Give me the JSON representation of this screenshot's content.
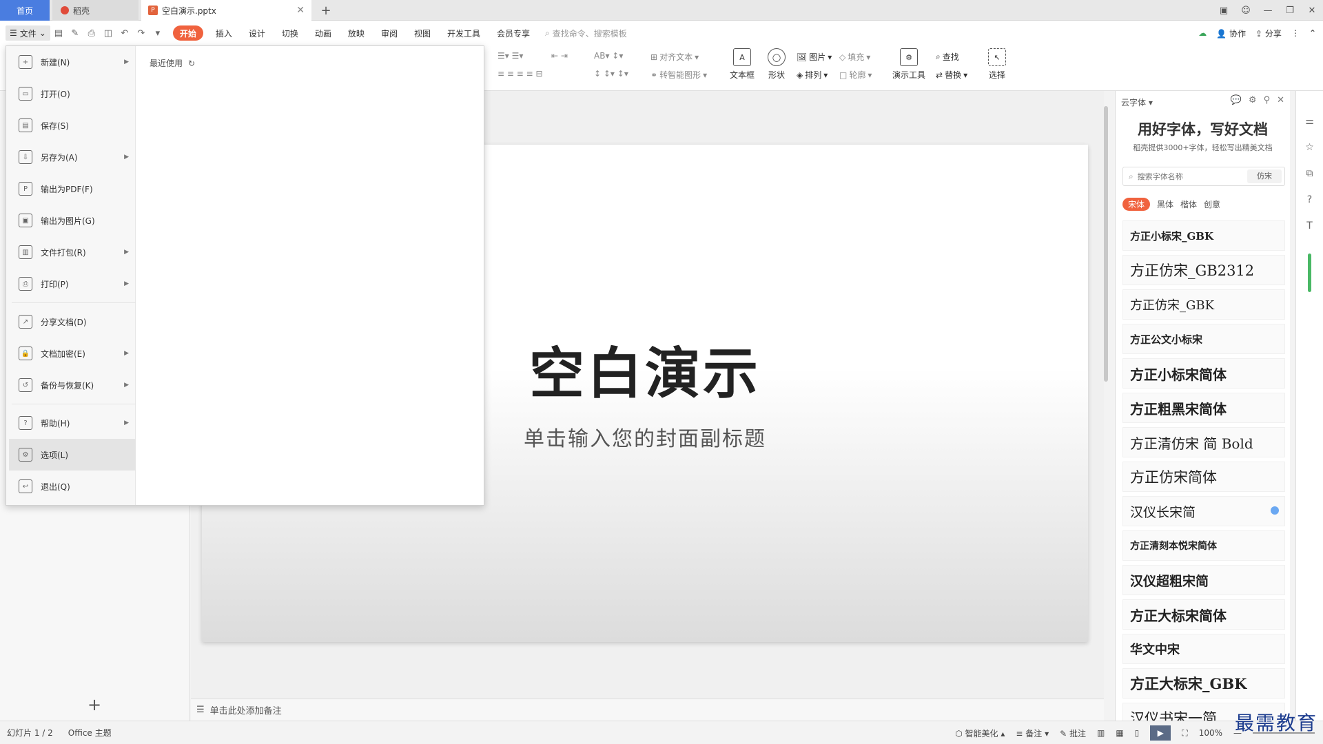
{
  "tabs": {
    "home": "首页",
    "docer": "稻壳",
    "file": "空白演示.pptx",
    "add": "+"
  },
  "menubar": {
    "file_menu_label": "文件",
    "tabs": [
      "开始",
      "插入",
      "设计",
      "切换",
      "动画",
      "放映",
      "审阅",
      "视图",
      "开发工具",
      "会员专享"
    ],
    "search_placeholder": "查找命令、搜索模板",
    "collab": "协作",
    "share": "分享"
  },
  "ribbon": {
    "align_text": "对齐文本",
    "smart_shape": "转智能图形",
    "textbox": "文本框",
    "shape": "形状",
    "picture": "图片",
    "fill": "填充",
    "arrange": "排列",
    "outline": "轮廓",
    "presentation_tools": "演示工具",
    "find": "查找",
    "replace": "替换",
    "select": "选择"
  },
  "file_menu": {
    "items": [
      {
        "label": "新建(N)",
        "arrow": true
      },
      {
        "label": "打开(O)",
        "arrow": false
      },
      {
        "label": "保存(S)",
        "arrow": false
      },
      {
        "label": "另存为(A)",
        "arrow": true
      },
      {
        "label": "输出为PDF(F)",
        "arrow": false
      },
      {
        "label": "输出为图片(G)",
        "arrow": false
      },
      {
        "label": "文件打包(R)",
        "arrow": true
      },
      {
        "label": "打印(P)",
        "arrow": true
      },
      {
        "label": "分享文档(D)",
        "arrow": false
      },
      {
        "label": "文档加密(E)",
        "arrow": true
      },
      {
        "label": "备份与恢复(K)",
        "arrow": true
      },
      {
        "label": "帮助(H)",
        "arrow": true
      },
      {
        "label": "选项(L)",
        "arrow": false
      },
      {
        "label": "退出(Q)",
        "arrow": false
      }
    ],
    "recent_label": "最近使用"
  },
  "slide": {
    "title": "空白演示",
    "subtitle": "单击输入您的封面副标题"
  },
  "notes_placeholder": "单击此处添加备注",
  "font_panel": {
    "header": "云字体",
    "title": "用好字体，写好文档",
    "description": "稻壳提供3000+字体，轻松写出精美文档",
    "search_placeholder": "搜索字体名称",
    "search_tag": "仿宋",
    "categories": [
      "宋体",
      "黑体",
      "楷体",
      "创意"
    ],
    "fonts": [
      "方正小标宋_GBK",
      "方正仿宋_GB2312",
      "方正仿宋_GBK",
      "方正公文小标宋",
      "方正小标宋简体",
      "方正粗黑宋简体",
      "方正清仿宋 简 Bold",
      "方正仿宋简体",
      "汉仪长宋简",
      "方正清刻本悦宋简体",
      "汉仪超粗宋简",
      "方正大标宋简体",
      "华文中宋",
      "方正大标宋_GBK",
      "汉仪书宋一简"
    ]
  },
  "statusbar": {
    "slide_counter": "幻灯片 1 / 2",
    "theme": "Office 主题",
    "beautify": "智能美化",
    "notes": "备注",
    "comments": "批注",
    "zoom": "100%"
  },
  "watermark": "最需教育",
  "colors": {
    "accent": "#f0623e",
    "home_tab": "#4a7de0",
    "progress_green": "#49b865"
  }
}
